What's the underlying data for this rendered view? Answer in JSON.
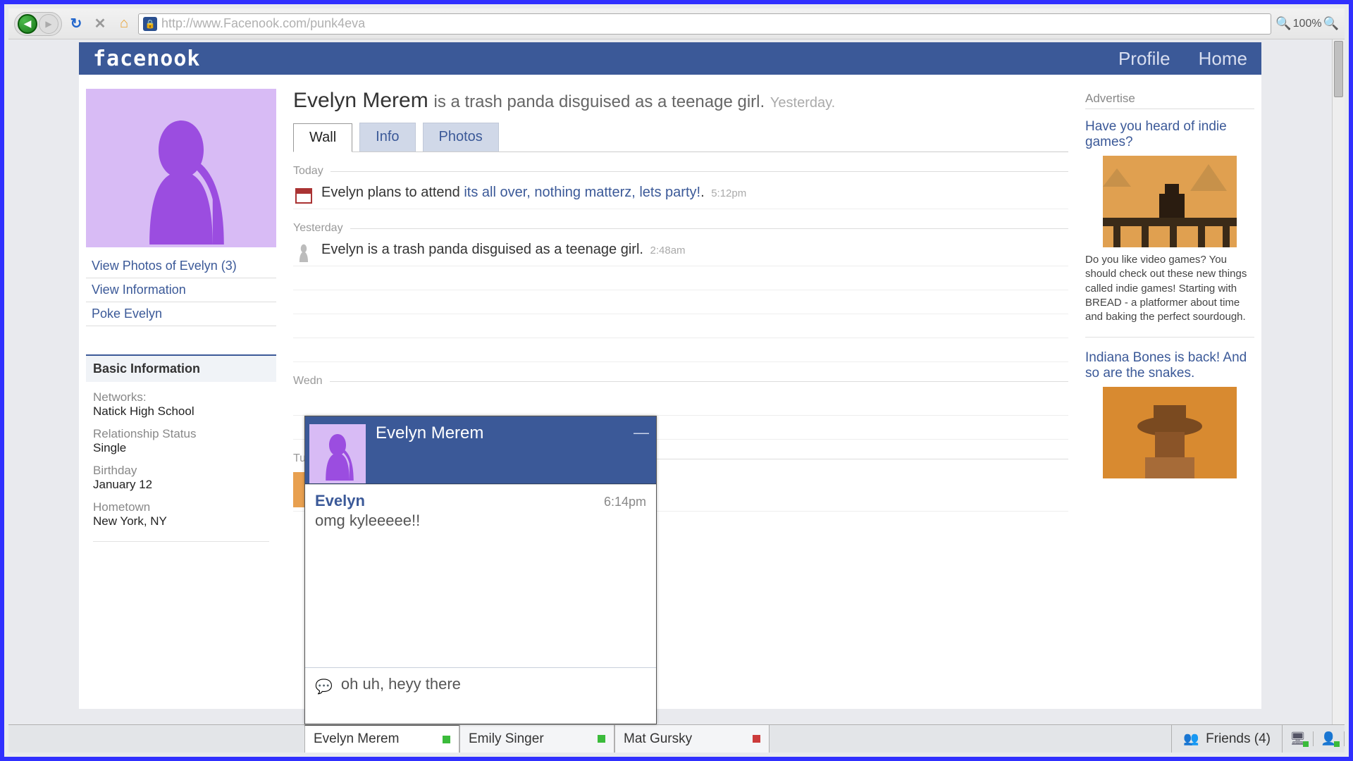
{
  "browser": {
    "url": "http://www.Facenook.com/punk4eva",
    "zoom": "100%"
  },
  "topbar": {
    "logo": "facenook",
    "links": {
      "profile": "Profile",
      "home": "Home"
    }
  },
  "profile": {
    "name": "Evelyn Merem",
    "status_text": "is a trash panda disguised as a teenage girl.",
    "status_time": "Yesterday.",
    "side_links": {
      "photos": "View Photos of Evelyn (3)",
      "info": "View Information",
      "poke": "Poke Evelyn"
    },
    "info_header": "Basic Information",
    "info": {
      "networks_label": "Networks:",
      "networks": "Natick High School",
      "rel_label": "Relationship Status",
      "rel": "Single",
      "bday_label": "Birthday",
      "bday": "January 12",
      "home_label": "Hometown",
      "home": "New York, NY"
    },
    "friends_header_partial": "Friends (4)"
  },
  "tabs": {
    "wall": "Wall",
    "info": "Info",
    "photos": "Photos"
  },
  "feed": {
    "today_label": "Today",
    "yesterday_label": "Yesterday",
    "wed_label": "Wedn",
    "tue_label": "Tues",
    "item1_prefix": "Evelyn plans to attend ",
    "item1_link": "its all over, nothing matterz, lets party!",
    "item1_suffix": ".",
    "item1_time": "5:12pm",
    "item2_text": "Evelyn is a trash panda disguised as a teenage girl.",
    "item2_time": "2:48am"
  },
  "ads": {
    "header": "Advertise",
    "ad1_title": "Have you heard of indie games?",
    "ad1_body": "Do you like video games? You should check out these new things called indie games! Starting with BREAD - a platformer about time and baking the perfect sourdough.",
    "ad2_title": "Indiana Bones is back! And so are the snakes."
  },
  "chat": {
    "name": "Evelyn Merem",
    "msg_sender": "Evelyn",
    "msg_time": "6:14pm",
    "msg_body": "omg kyleeeee!!",
    "input_text": "oh uh, heyy there"
  },
  "chatbar": {
    "tabs": [
      {
        "name": "Evelyn Merem",
        "status": "green"
      },
      {
        "name": "Emily Singer",
        "status": "green"
      },
      {
        "name": "Mat Gursky",
        "status": "red"
      }
    ],
    "friends_label": "Friends (4)"
  }
}
